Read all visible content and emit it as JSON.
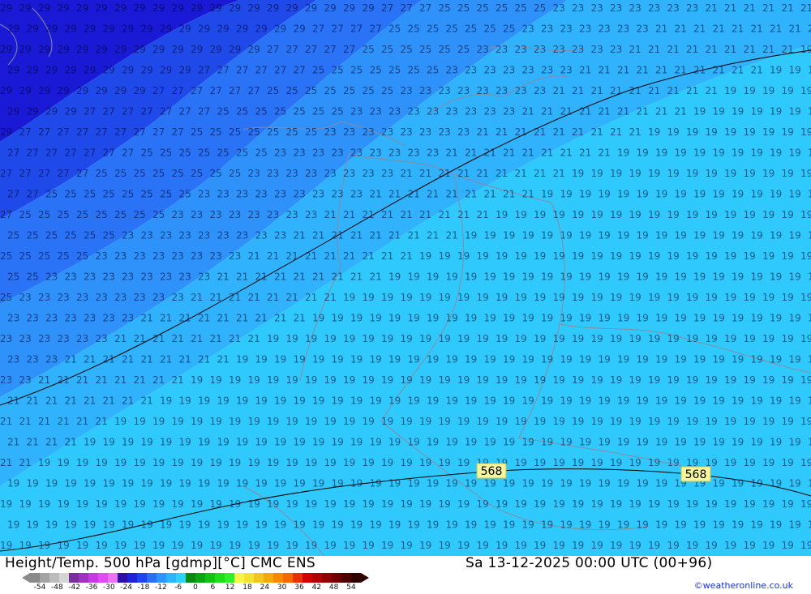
{
  "header": {
    "title_left": "Height/Temp. 500 hPa [gdmp][°C] CMC ENS",
    "title_right": "Sa 13-12-2025 00:00 UTC (00+96)"
  },
  "map": {
    "contour_labels": [
      "568",
      "568"
    ],
    "temperature_bands": [
      {
        "value": -29,
        "color": "#1a1ad6"
      },
      {
        "value": -27,
        "color": "#2049ea"
      },
      {
        "value": -25,
        "color": "#2a72f6"
      },
      {
        "value": -23,
        "color": "#2f92fb"
      },
      {
        "value": -21,
        "color": "#30b2fd"
      },
      {
        "value": -19,
        "color": "#30c9fd"
      }
    ],
    "border_color": "#8a8aa0",
    "contour_color": "#000000"
  },
  "legend": {
    "scale_labels": [
      "-54",
      "-48",
      "-42",
      "-36",
      "-30",
      "-24",
      "-18",
      "-12",
      "-6",
      "0",
      "6",
      "12",
      "18",
      "24",
      "30",
      "36",
      "42",
      "48",
      "54"
    ],
    "colors": [
      "#8a8a8a",
      "#a3a3a3",
      "#bcbcbc",
      "#d4d4d4",
      "#7a2ea0",
      "#a02fc4",
      "#c43ae0",
      "#e04cf0",
      "#f070f5",
      "#2c10a8",
      "#1f22d8",
      "#2044ee",
      "#2a6ef6",
      "#2f93fb",
      "#30b3fd",
      "#30d0fc",
      "#0d8a0d",
      "#0ea60e",
      "#13c213",
      "#1ddd1d",
      "#2ef02e",
      "#f5f548",
      "#f5e034",
      "#f5c420",
      "#f5a80c",
      "#f58a00",
      "#f56800",
      "#e83000",
      "#d00000",
      "#b00000",
      "#900000",
      "#700000",
      "#500000",
      "#300000"
    ]
  },
  "credit": "©weatheronline.co.uk"
}
